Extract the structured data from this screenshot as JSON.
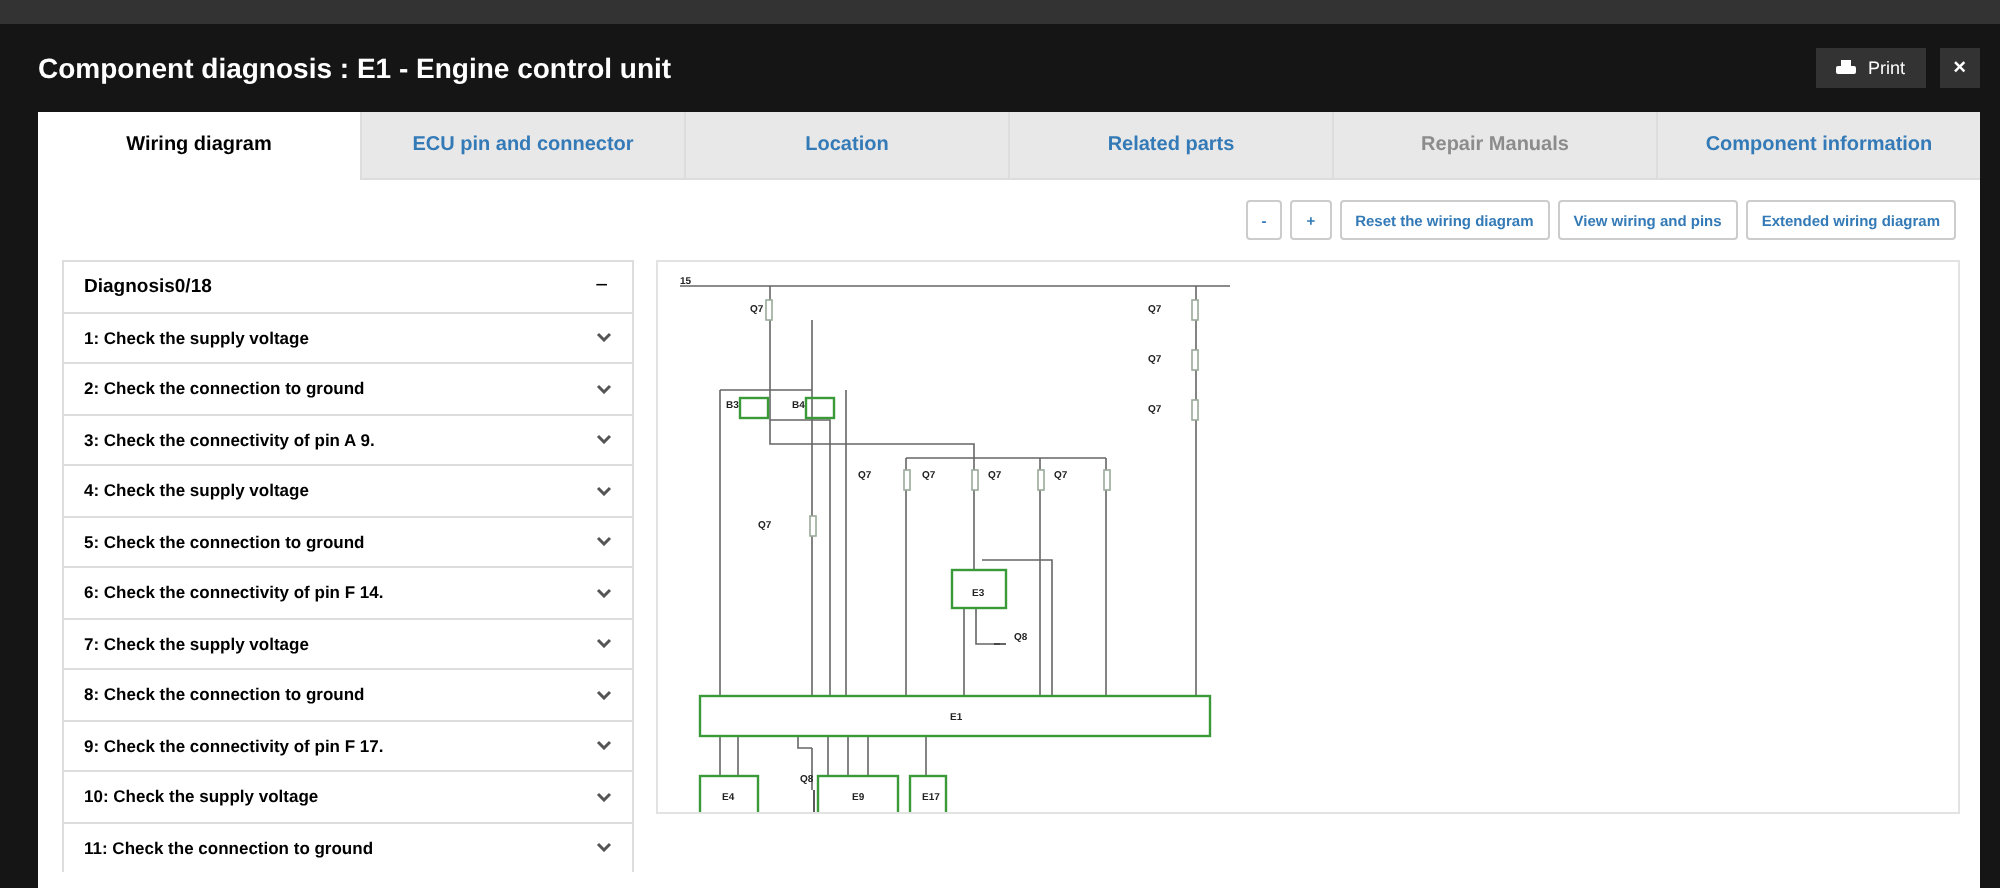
{
  "window": {
    "title": "Component diagnosis : E1 - Engine control unit",
    "print_label": "Print",
    "close_symbol": "×"
  },
  "tabs": [
    {
      "label": "Wiring diagram",
      "selected": true,
      "disabled": false
    },
    {
      "label": "ECU pin and connector",
      "selected": false,
      "disabled": false
    },
    {
      "label": "Location",
      "selected": false,
      "disabled": false
    },
    {
      "label": "Related parts",
      "selected": false,
      "disabled": false
    },
    {
      "label": "Repair Manuals",
      "selected": false,
      "disabled": true
    },
    {
      "label": "Component information",
      "selected": false,
      "disabled": false
    }
  ],
  "toolbar": [
    "-",
    "+",
    "Reset the wiring diagram",
    "View wiring and pins",
    "Extended wiring diagram"
  ],
  "diagnosis": {
    "title": "Diagnosis0/18",
    "collapse_symbol": "−",
    "items": [
      "1: Check the supply voltage",
      "2: Check the connection to ground",
      "3: Check the connectivity of pin A 9.",
      "4: Check the supply voltage",
      "5: Check the connection to ground",
      "6: Check the connectivity of pin F 14.",
      "7: Check the supply voltage",
      "8: Check the connection to ground",
      "9: Check the connectivity of pin F 17.",
      "10: Check the supply voltage",
      "11: Check the connection to ground"
    ]
  },
  "diagram": {
    "labels": [
      "15",
      "Q7",
      "Q7",
      "Q7",
      "Q7",
      "B3",
      "B4",
      "Q7",
      "Q7",
      "Q7",
      "Q7",
      "Q7",
      "E3",
      "Q8",
      "E1",
      "E4",
      "Q8",
      "E9",
      "E17"
    ]
  }
}
